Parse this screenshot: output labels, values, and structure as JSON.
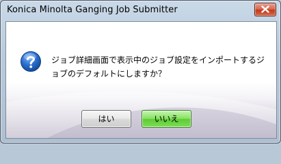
{
  "window": {
    "title": "Konica Minolta Ganging Job Submitter",
    "close_icon": "close-icon"
  },
  "dialog": {
    "icon": "question-icon",
    "message": "ジョブ詳細画面で表示中のジョブ設定をインポートするジョブのデフォルトにしますか？",
    "buttons": {
      "yes_label": "はい",
      "no_label": "いいえ"
    }
  },
  "colors": {
    "icon_blue": "#1f5fbf",
    "close_red": "#c2391d",
    "default_button_green": "#5ccd34"
  }
}
